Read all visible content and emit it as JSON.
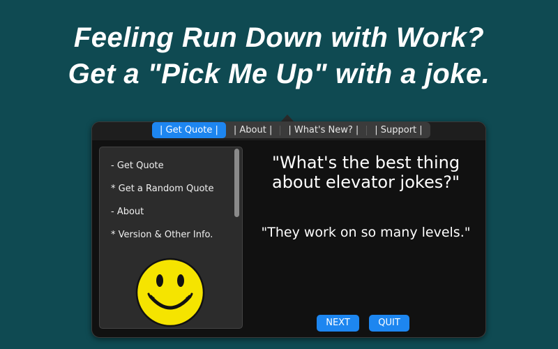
{
  "headline": {
    "line1": "Feeling Run Down with Work?",
    "line2": "Get a \"Pick Me Up\" with a joke."
  },
  "tabs": [
    {
      "label": "| Get Quote |",
      "active": true
    },
    {
      "label": "| About |",
      "active": false
    },
    {
      "label": "| What's New? |",
      "active": false
    },
    {
      "label": "| Support |",
      "active": false
    }
  ],
  "sidebar": {
    "items": [
      {
        "label": "- Get Quote"
      },
      {
        "label": "* Get a Random Quote"
      },
      {
        "label": "- About"
      },
      {
        "label": "* Version & Other Info."
      }
    ],
    "image_icon": "smiley-face"
  },
  "quote": {
    "question": "\"What's the best thing about elevator jokes?\"",
    "answer": "\"They work on so many levels.\""
  },
  "buttons": {
    "next": "NEXT",
    "quit": "QUIT"
  },
  "colors": {
    "background": "#0f4a52",
    "accent": "#1d86f0",
    "panel": "#111111",
    "smiley_yellow": "#f5e400"
  }
}
